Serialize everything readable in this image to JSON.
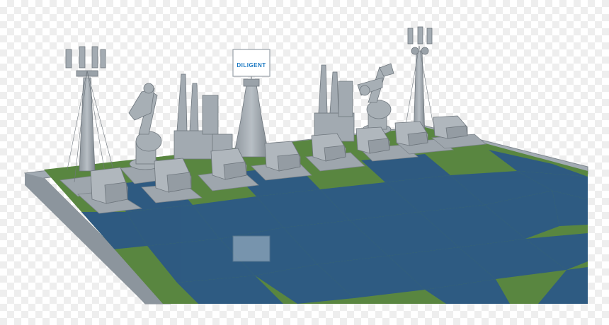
{
  "scene": {
    "sign_text": "DILIGENT",
    "colors": {
      "board_green": "#5d8f3e",
      "board_blue": "#1f4f7f",
      "frame": "#9aa3ab",
      "piece": "#a9b0b6",
      "piece_dark": "#7d858c",
      "sign_blue": "#1a78c2"
    },
    "icons": [
      "cell-tower-icon",
      "robot-arm-icon",
      "factory-icon",
      "van-icon",
      "billboard-icon"
    ]
  }
}
